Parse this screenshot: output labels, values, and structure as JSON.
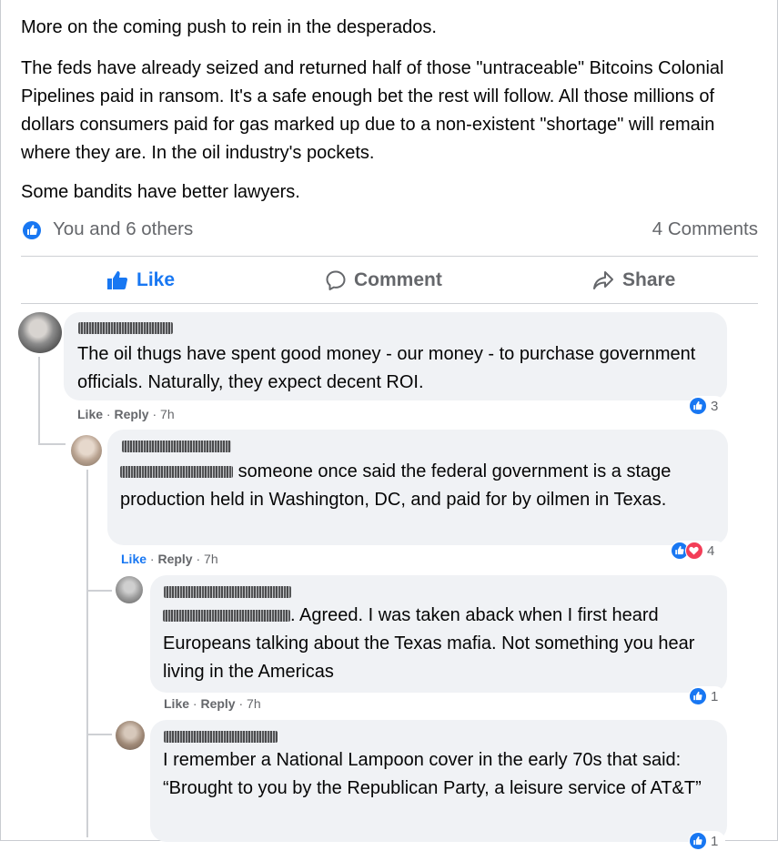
{
  "post": {
    "paragraphs": [
      "More on the coming push to rein in the desperados.",
      "The feds have already seized and returned half of those \"untraceable\" Bitcoins Colonial Pipelines paid in ransom. It's a safe enough bet the rest will follow. All those millions of dollars consumers paid for gas marked up due to a non-existent \"shortage\" will remain where they are. In the oil industry's pockets.",
      "Some bandits have better lawyers."
    ],
    "reactions_text": "You and 6 others",
    "comments_count": "4 Comments"
  },
  "actions": {
    "like": "Like",
    "comment": "Comment",
    "share": "Share"
  },
  "comments": [
    {
      "text": "The oil thugs have spent good money - our money - to purchase government officials. Naturally, they expect decent ROI.",
      "like_label": "Like",
      "reply_label": "Reply",
      "time": "7h",
      "reaction_count": "3",
      "reactions": [
        "like"
      ]
    },
    {
      "text": "someone once said the federal government is a stage production held in Washington, DC, and paid for by oilmen in Texas.",
      "like_label": "Like",
      "reply_label": "Reply",
      "time": "7h",
      "reaction_count": "4",
      "reactions": [
        "like",
        "love"
      ],
      "liked_by_you": true
    },
    {
      "text": ". Agreed. I was taken aback when I first heard Europeans talking about the Texas mafia. Not something you hear living in the Americas",
      "like_label": "Like",
      "reply_label": "Reply",
      "time": "7h",
      "reaction_count": "1",
      "reactions": [
        "like"
      ]
    },
    {
      "text": "I remember a National Lampoon cover in the early 70s that said: “Brought to you by the Republican Party, a leisure service of AT&T”",
      "reaction_count": "1",
      "reactions": [
        "like"
      ]
    }
  ],
  "colors": {
    "accent": "#1877f2",
    "bubble": "#f0f2f5",
    "secondary_text": "#65676b",
    "love": "#f33e58"
  }
}
